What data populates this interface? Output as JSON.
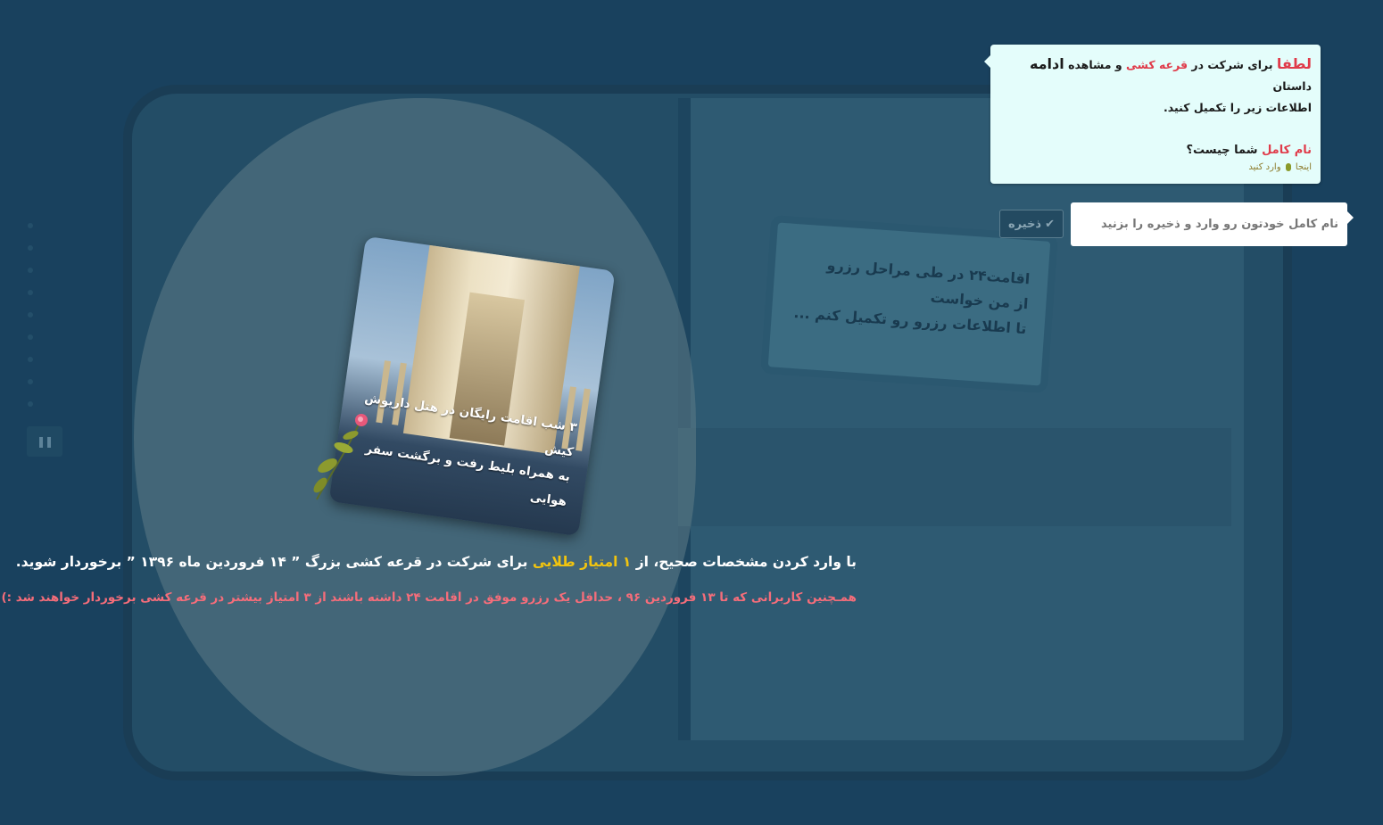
{
  "dialog": {
    "please": "لطفا",
    "text_a": " برای شرکت در ",
    "lottery": "قرعه کشی",
    "text_b": " و مشاهده ",
    "continue_word": "ادامه",
    "text_c": " داستان",
    "line2": "اطلاعات زیر را تکمیل کنید.",
    "q_name": "نام کامل",
    "q_rest": " شما چیست؟",
    "enter_here_a": "اینجا",
    "enter_here_b": "وارد کنید"
  },
  "form": {
    "name_placeholder": "نام کامل خودتون رو وارد و ذخیره را بزنید",
    "save_label": "ذخیره",
    "save_icon": "check-icon"
  },
  "prize_card": {
    "line1": "۳ شب اقامت رایگان در هتل داریوش کیش",
    "line2": "به همراه بلیط رفت و برگشت سفر هوایی"
  },
  "background_sign": {
    "line1": "اقامت۲۴ در طی مراحل رزرو",
    "line2": "از من خواست",
    "line3": "تا اطلاعات رزرو رو تکمیل کنم ..."
  },
  "caption": {
    "part1": "با وارد کردن مشخصات صحیح، از ",
    "gold": "۱ امتیاز طلایی",
    "part2": " برای شرکت در قرعه کشی بزرگ ” ۱۴ فروردین ماه ۱۳۹۶ ” برخوردار شوید.",
    "sub": "همـچنین کاربرانی که تا ۱۳ فروردین ۹۶ ، حداقل یک رزرو موفق در اقامت ۲۴ داشته باشند از ۳ امتیاز بیشتر در قرعه کشی برخوردار خواهند شد :)"
  },
  "player": {
    "pause_icon": "pause-icon",
    "slide_count": 9
  },
  "colors": {
    "background": "#19415e",
    "accent_red": "#e03b4a",
    "accent_gold": "#f1c40f",
    "dialog_bg": "#e4fdfb"
  }
}
